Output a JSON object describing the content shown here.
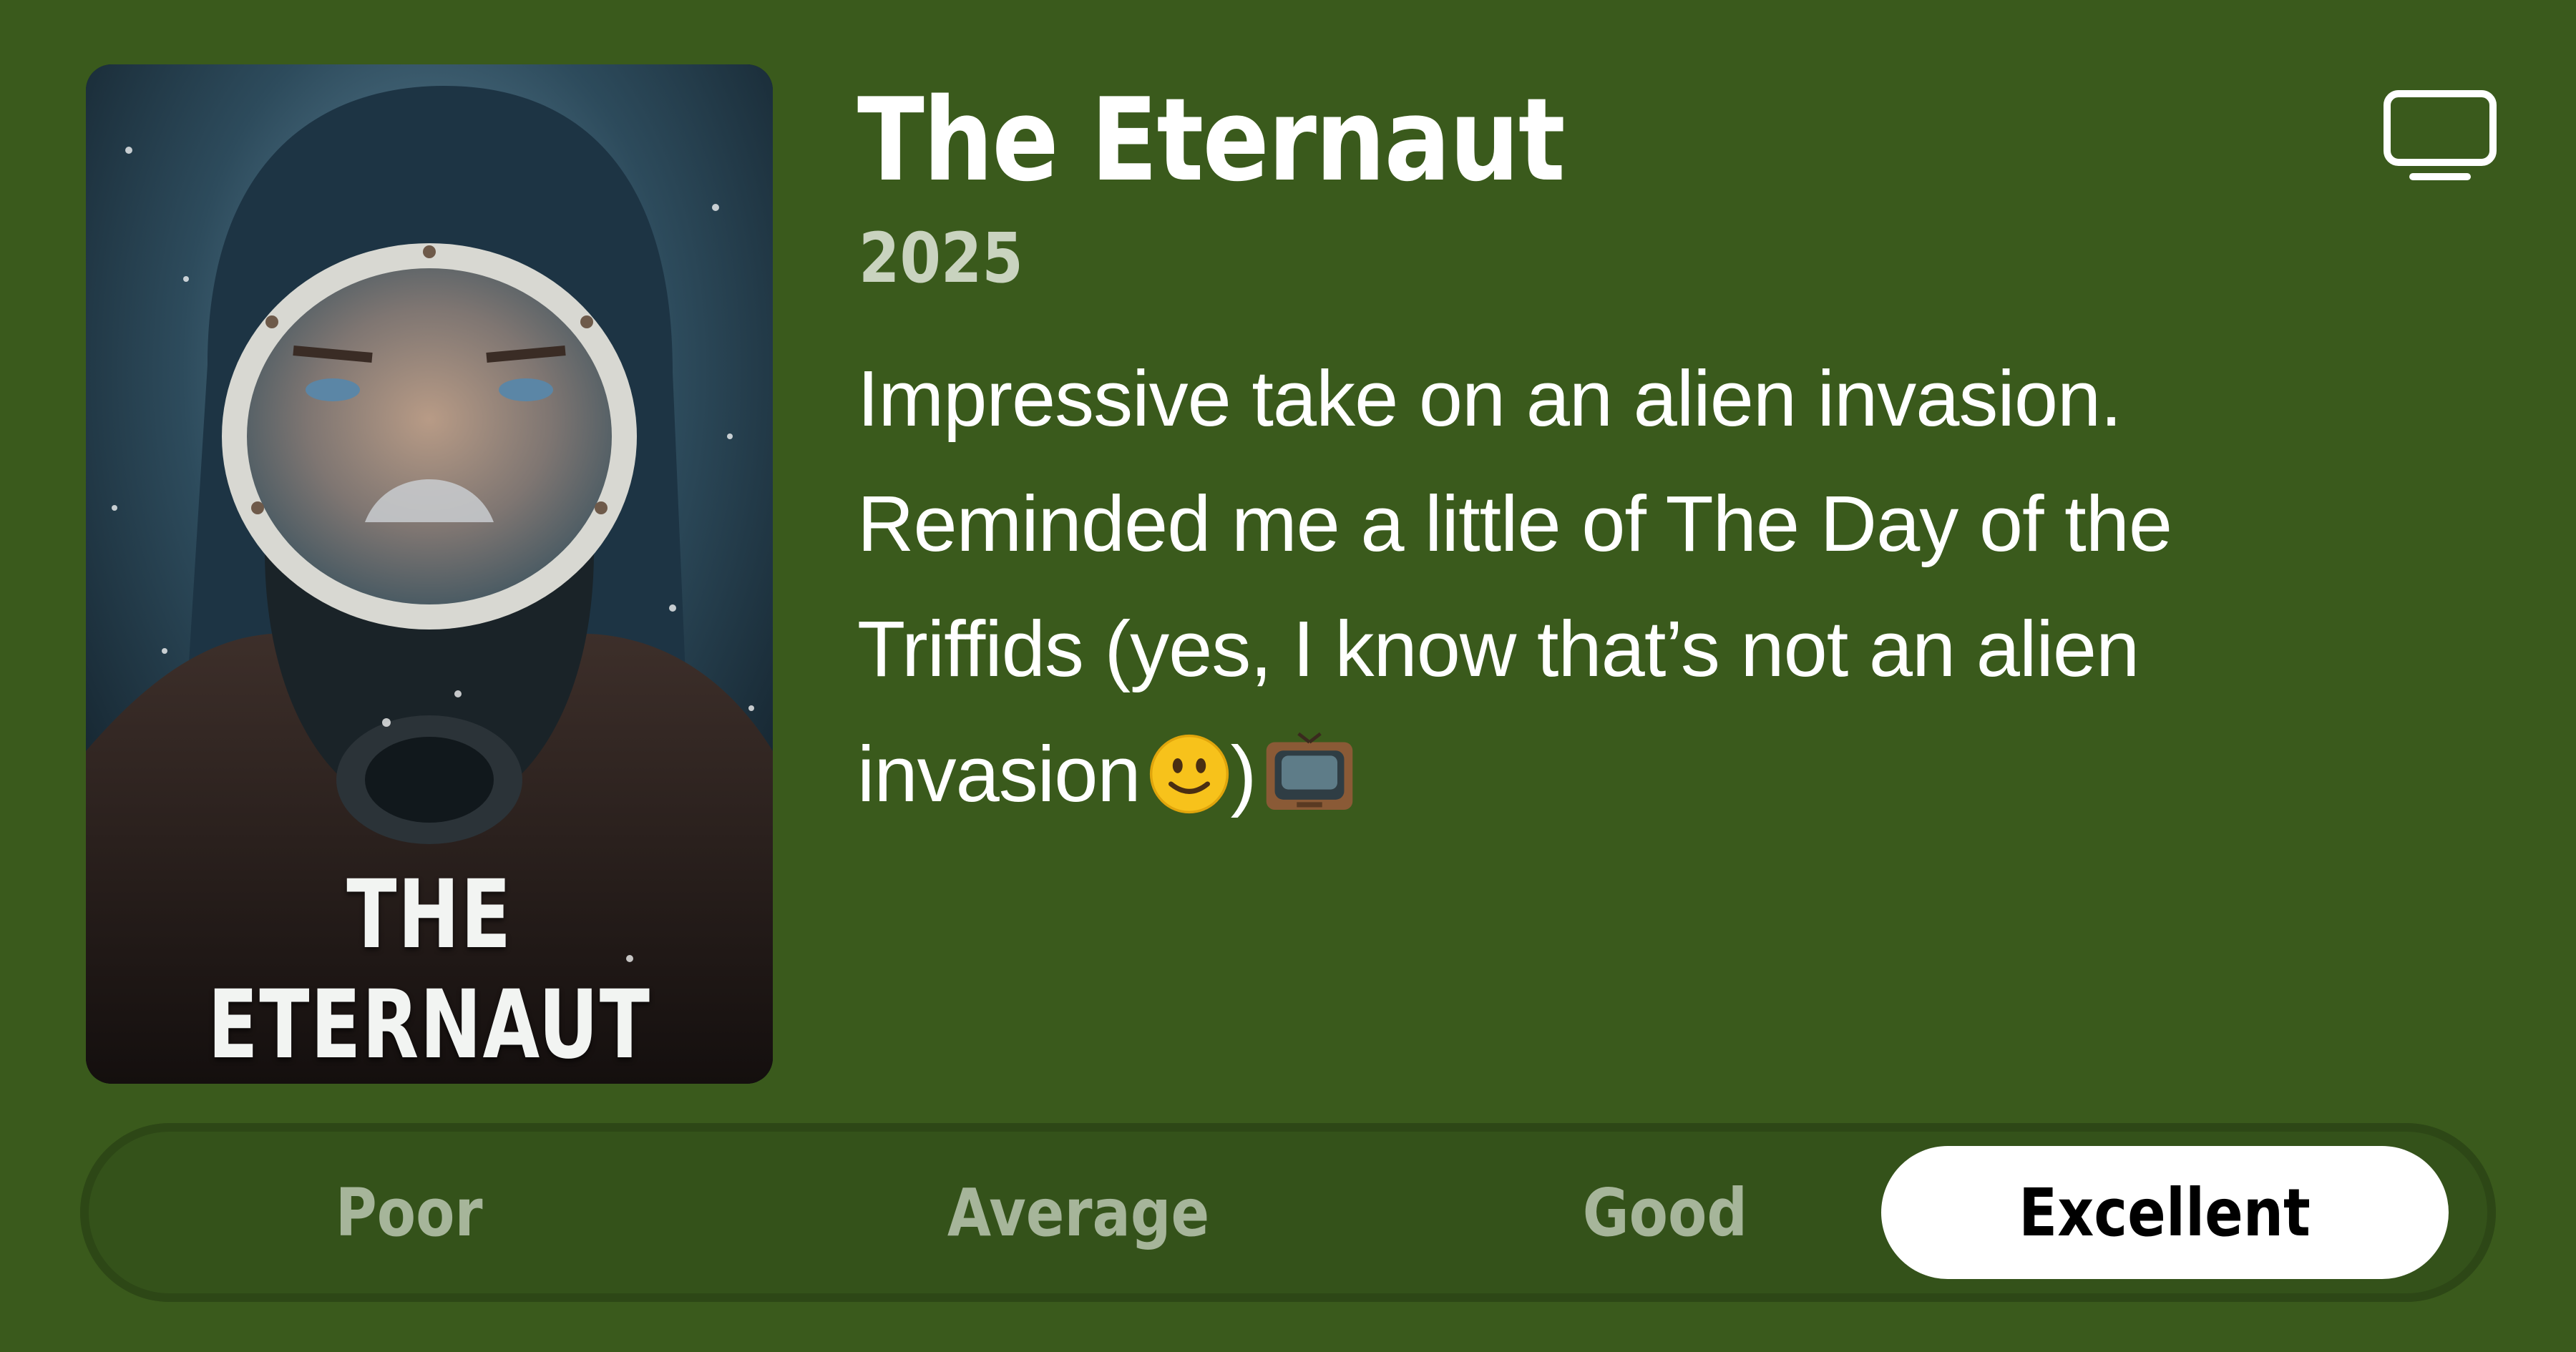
{
  "show": {
    "title": "The Eternaut",
    "year": "2025",
    "poster_title": "THE ETERNAUT",
    "review": "Impressive take on an alien invasion.\nReminded me a little of The Day of the\nTriffids (yes, I know that’s not an alien\ninvasion",
    "review_tail": ")",
    "type_icon": "tv-icon"
  },
  "rating": {
    "options": [
      "Poor",
      "Average",
      "Good",
      "Excellent"
    ],
    "selected": "Excellent"
  },
  "colors": {
    "background": "#3a5a1c",
    "selected_pill": "#ffffff",
    "unselected_text": "#a6b59a"
  }
}
